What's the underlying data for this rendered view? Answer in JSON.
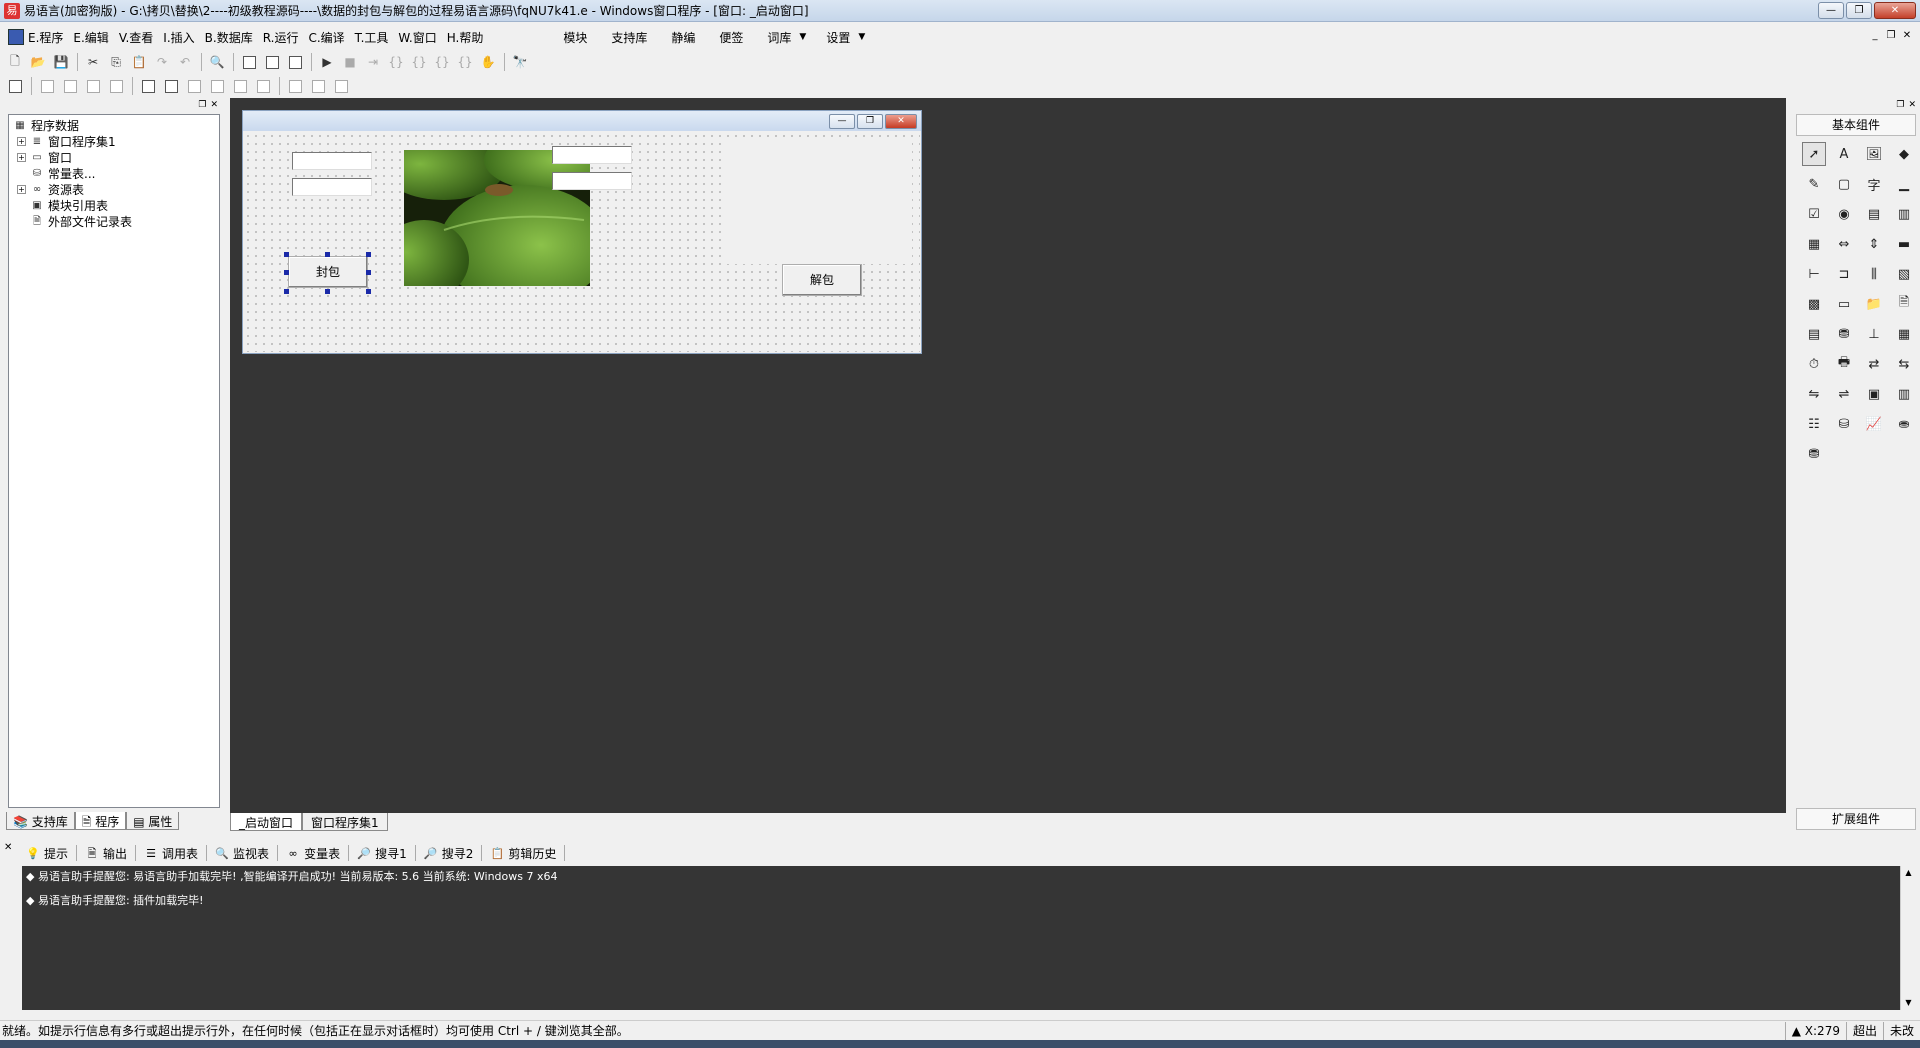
{
  "window": {
    "title": "易语言(加密狗版) - G:\\拷贝\\替换\\2----初级教程源码----\\数据的封包与解包的过程易语言源码\\fqNU7k41.e - Windows窗口程序 - [窗口: _启动窗口]"
  },
  "menu": {
    "items": [
      "E.程序",
      "E.编辑",
      "V.查看",
      "I.插入",
      "B.数据库",
      "R.运行",
      "C.编译",
      "T.工具",
      "W.窗口",
      "H.帮助"
    ],
    "extra": [
      "模块",
      "支持库",
      "静编",
      "便签",
      "词库",
      "设置"
    ]
  },
  "tree": {
    "root": "程序数据",
    "nodes": [
      {
        "label": "窗口程序集1",
        "icon": "module-icon",
        "expandable": true
      },
      {
        "label": "窗口",
        "icon": "window-icon",
        "expandable": true
      },
      {
        "label": "常量表...",
        "icon": "constant-icon",
        "expandable": false
      },
      {
        "label": "资源表",
        "icon": "resource-icon",
        "expandable": true
      },
      {
        "label": "模块引用表",
        "icon": "module-ref-icon",
        "expandable": false
      },
      {
        "label": "外部文件记录表",
        "icon": "file-record-icon",
        "expandable": false
      }
    ]
  },
  "left_tabs": [
    "支持库",
    "程序",
    "属性"
  ],
  "form": {
    "button_pack": "封包",
    "button_unpack": "解包"
  },
  "design_tabs": [
    "_启动窗口",
    "窗口程序集1"
  ],
  "components": {
    "header": "基本组件",
    "footer": "扩展组件"
  },
  "output_tabs": [
    "提示",
    "输出",
    "调用表",
    "监视表",
    "变量表",
    "搜寻1",
    "搜寻2",
    "剪辑历史"
  ],
  "output_lines": [
    "易语言助手提醒您: 易语言助手加载完毕! ,智能编译开启成功! 当前易版本: 5.6 当前系统: Windows 7 x64",
    "易语言助手提醒您: 插件加载完毕!"
  ],
  "status": {
    "message": "就绪。如提示行信息有多行或超出提示行外，在任何时候（包括正在显示对话框时）均可使用 Ctrl + / 键浏览其全部。",
    "coord": "X:279",
    "mode": "超出",
    "state": "未改"
  }
}
